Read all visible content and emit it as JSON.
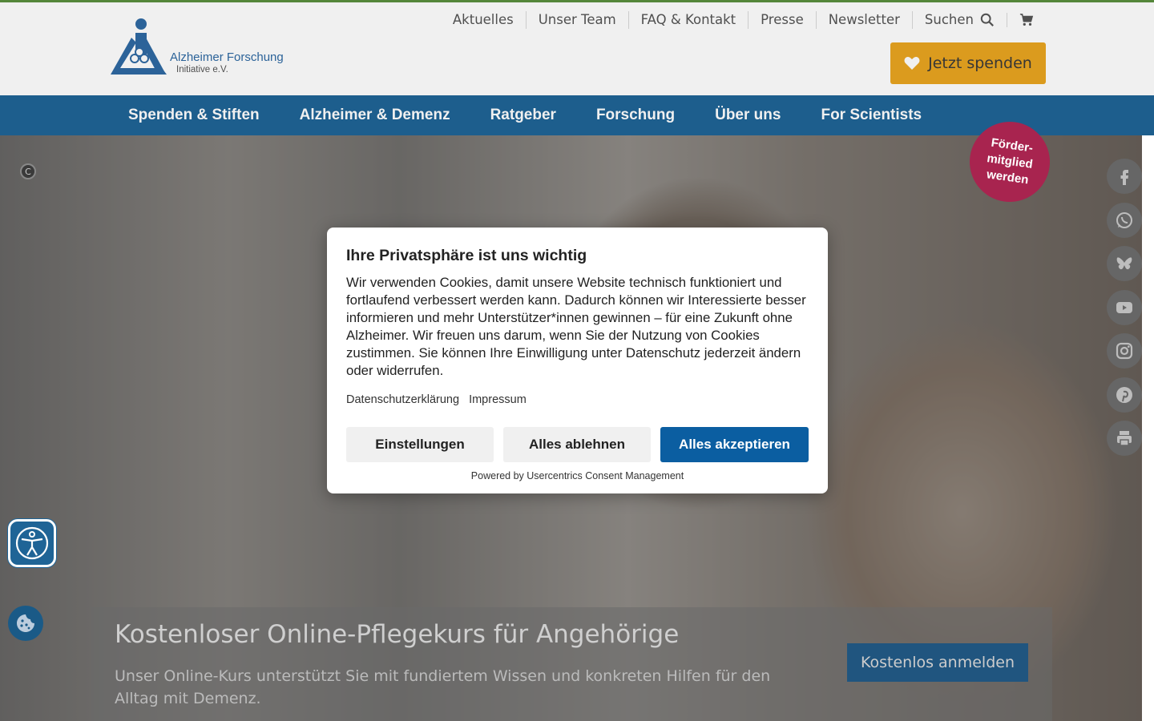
{
  "header": {
    "logo_line1": "Alzheimer Forschung",
    "logo_line2": "Initiative e.V.",
    "top_links": [
      "Aktuelles",
      "Unser Team",
      "FAQ & Kontakt",
      "Presse",
      "Newsletter",
      "Suchen"
    ],
    "donate_label": "Jetzt spenden"
  },
  "main_nav": [
    "Spenden & Stiften",
    "Alzheimer & Demenz",
    "Ratgeber",
    "Forschung",
    "Über uns",
    "For Scientists"
  ],
  "badge": {
    "line1": "Förder-",
    "line2": "mitglied",
    "line3": "werden"
  },
  "copyright_symbol": "C",
  "social_icons": [
    "facebook-icon",
    "whatsapp-icon",
    "bluesky-icon",
    "youtube-icon",
    "instagram-icon",
    "pinterest-icon",
    "print-icon"
  ],
  "promo": {
    "title": "Kostenloser Online-Pflegekurs für Angehörige",
    "text": "Unser Online-Kurs unterstützt Sie mit fundiertem Wissen und konkreten Hilfen für den Alltag mit Demenz.",
    "button": "Kostenlos anmelden"
  },
  "consent": {
    "title": "Ihre Privatsphäre ist uns wichtig",
    "text": "Wir verwenden Cookies, damit unsere Website technisch funktioniert und fortlaufend verbessert werden kann. Dadurch können wir Interessierte besser informieren und mehr Unterstützer*innen gewinnen – für eine Zukunft ohne Alzheimer. Wir freuen uns darum, wenn Sie der Nutzung von Cookies zustimmen. Sie können Ihre Einwilligung unter Datenschutz jederzeit ändern oder widerrufen.",
    "link_privacy": "Datenschutzerklärung",
    "link_imprint": "Impressum",
    "btn_settings": "Einstellungen",
    "btn_reject": "Alles ablehnen",
    "btn_accept": "Alles akzeptieren",
    "powered_by": "Powered by Usercentrics Consent Management"
  },
  "colors": {
    "brand_blue": "#1f6496",
    "donate_orange": "#e9a520",
    "badge_red": "#a8244f",
    "accept_blue": "#0b5ea1",
    "top_green": "#5a8f3e"
  }
}
